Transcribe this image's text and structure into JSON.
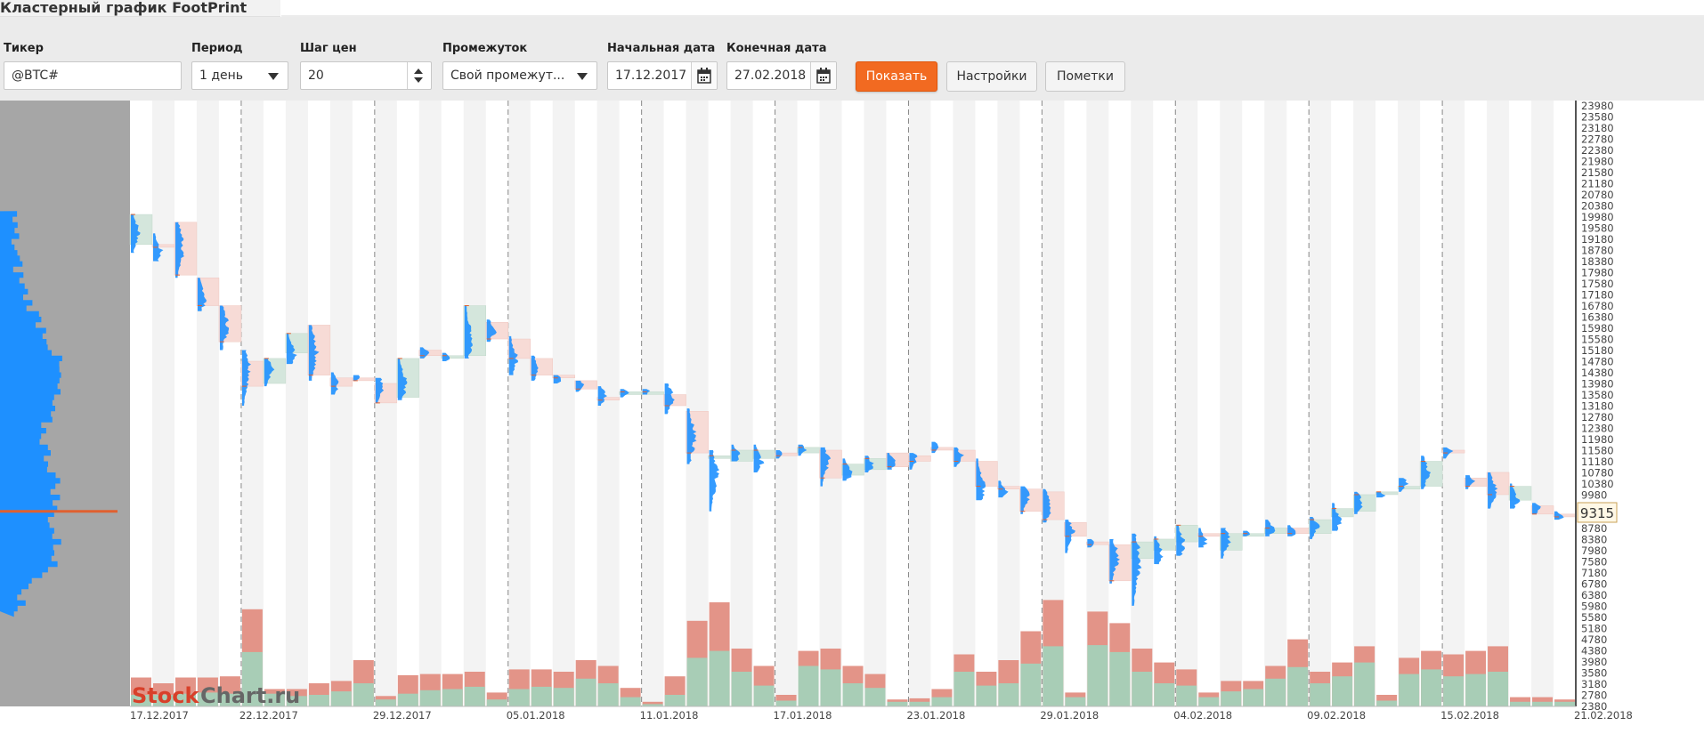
{
  "page": {
    "title": "Кластерный график FootPrint"
  },
  "toolbar": {
    "ticker": {
      "label": "Тикер",
      "value": "@BTC#"
    },
    "period": {
      "label": "Период",
      "value": "1 день"
    },
    "price_step": {
      "label": "Шаг цен",
      "value": "20"
    },
    "range": {
      "label": "Промежуток",
      "value": "Свой промежут..."
    },
    "start_date": {
      "label": "Начальная дата",
      "value": "17.12.2017"
    },
    "end_date": {
      "label": "Конечная дата",
      "value": "27.02.2018"
    },
    "show_label": "Показать",
    "settings_label": "Настройки",
    "marks_label": "Пометки"
  },
  "colors": {
    "accent": "#f26a21",
    "bull": "#a8cdb6",
    "bear": "#e39488",
    "profile": "#1e90ff",
    "poc": "#e06030"
  },
  "watermark": {
    "part1": "Stock",
    "part2": "Chart.ru"
  },
  "chart_data": {
    "type": "footprint",
    "y_ticks": [
      23980,
      23580,
      23180,
      22780,
      22380,
      21980,
      21580,
      21180,
      20780,
      20380,
      19980,
      19580,
      19180,
      18780,
      18380,
      17980,
      17580,
      17180,
      16780,
      16380,
      15980,
      15580,
      15180,
      14780,
      14380,
      13980,
      13580,
      13180,
      12780,
      12380,
      11980,
      11580,
      11180,
      10780,
      10380,
      9980,
      9580,
      9180,
      8780,
      8380,
      7980,
      7580,
      7180,
      6780,
      6380,
      5980,
      5580,
      5180,
      4780,
      4380,
      3980,
      3580,
      3180,
      2780,
      2380
    ],
    "x_labels": [
      "17.12.2017",
      "22.12.2017",
      "29.12.2017",
      "05.01.2018",
      "11.01.2018",
      "17.01.2018",
      "23.01.2018",
      "29.01.2018",
      "04.02.2018",
      "09.02.2018",
      "15.02.2018",
      "21.02.2018"
    ],
    "current_price": "9315",
    "ylim": [
      2380,
      24180
    ],
    "candles": [
      {
        "o": 19000,
        "c": 20080,
        "h": 20080,
        "l": 18700
      },
      {
        "o": 19000,
        "c": 18900,
        "h": 19400,
        "l": 18400
      },
      {
        "o": 19800,
        "c": 17900,
        "h": 19800,
        "l": 17800
      },
      {
        "o": 17800,
        "c": 16800,
        "h": 17800,
        "l": 16600
      },
      {
        "o": 16800,
        "c": 15500,
        "h": 16800,
        "l": 15200
      },
      {
        "o": 14800,
        "c": 13900,
        "h": 15200,
        "l": 13200
      },
      {
        "o": 14000,
        "c": 14900,
        "h": 14900,
        "l": 13900
      },
      {
        "o": 15100,
        "c": 15800,
        "h": 15800,
        "l": 14700
      },
      {
        "o": 16100,
        "c": 14300,
        "h": 16100,
        "l": 14100
      },
      {
        "o": 14200,
        "c": 13900,
        "h": 14400,
        "l": 13600
      },
      {
        "o": 14200,
        "c": 14100,
        "h": 14300,
        "l": 14100
      },
      {
        "o": 14000,
        "c": 13300,
        "h": 14200,
        "l": 13300
      },
      {
        "o": 13500,
        "c": 14900,
        "h": 14900,
        "l": 13400
      },
      {
        "o": 15200,
        "c": 15000,
        "h": 15300,
        "l": 14900
      },
      {
        "o": 15000,
        "c": 15000,
        "h": 15100,
        "l": 14800
      },
      {
        "o": 15000,
        "c": 16800,
        "h": 16800,
        "l": 14900
      },
      {
        "o": 16200,
        "c": 15600,
        "h": 16300,
        "l": 15500
      },
      {
        "o": 15600,
        "c": 14900,
        "h": 15700,
        "l": 14300
      },
      {
        "o": 14900,
        "c": 14300,
        "h": 15000,
        "l": 14100
      },
      {
        "o": 14300,
        "c": 14200,
        "h": 14300,
        "l": 14000
      },
      {
        "o": 14100,
        "c": 13800,
        "h": 14100,
        "l": 13700
      },
      {
        "o": 13500,
        "c": 13400,
        "h": 13900,
        "l": 13200
      },
      {
        "o": 13600,
        "c": 13700,
        "h": 13800,
        "l": 13500
      },
      {
        "o": 13700,
        "c": 13700,
        "h": 13800,
        "l": 13600
      },
      {
        "o": 13600,
        "c": 13200,
        "h": 14000,
        "l": 12900
      },
      {
        "o": 13000,
        "c": 11500,
        "h": 13100,
        "l": 11100
      },
      {
        "o": 11300,
        "c": 11400,
        "h": 11600,
        "l": 9400
      },
      {
        "o": 11200,
        "c": 11600,
        "h": 11800,
        "l": 11200
      },
      {
        "o": 11300,
        "c": 11600,
        "h": 11800,
        "l": 10800
      },
      {
        "o": 11500,
        "c": 11400,
        "h": 11600,
        "l": 11300
      },
      {
        "o": 11500,
        "c": 11700,
        "h": 11800,
        "l": 11400
      },
      {
        "o": 11600,
        "c": 10600,
        "h": 11700,
        "l": 10300
      },
      {
        "o": 10700,
        "c": 11100,
        "h": 11300,
        "l": 10500
      },
      {
        "o": 10900,
        "c": 11300,
        "h": 11400,
        "l": 10800
      },
      {
        "o": 11500,
        "c": 11000,
        "h": 11500,
        "l": 10900
      },
      {
        "o": 11400,
        "c": 11200,
        "h": 11500,
        "l": 10900
      },
      {
        "o": 11700,
        "c": 11600,
        "h": 11900,
        "l": 11500
      },
      {
        "o": 11600,
        "c": 11200,
        "h": 11700,
        "l": 11000
      },
      {
        "o": 11200,
        "c": 10300,
        "h": 11300,
        "l": 9800
      },
      {
        "o": 10300,
        "c": 10200,
        "h": 10500,
        "l": 9900
      },
      {
        "o": 10200,
        "c": 9400,
        "h": 10300,
        "l": 9300
      },
      {
        "o": 10100,
        "c": 9100,
        "h": 10200,
        "l": 9000
      },
      {
        "o": 9000,
        "c": 8500,
        "h": 9100,
        "l": 7900
      },
      {
        "o": 8300,
        "c": 8200,
        "h": 8400,
        "l": 8100
      },
      {
        "o": 8200,
        "c": 6900,
        "h": 8400,
        "l": 6800
      },
      {
        "o": 7700,
        "c": 8300,
        "h": 8600,
        "l": 6000
      },
      {
        "o": 8000,
        "c": 8400,
        "h": 8500,
        "l": 7500
      },
      {
        "o": 8300,
        "c": 8900,
        "h": 8900,
        "l": 7800
      },
      {
        "o": 8600,
        "c": 8500,
        "h": 8800,
        "l": 8100
      },
      {
        "o": 8000,
        "c": 8600,
        "h": 8800,
        "l": 7700
      },
      {
        "o": 8500,
        "c": 8600,
        "h": 8700,
        "l": 8500
      },
      {
        "o": 8600,
        "c": 8800,
        "h": 9100,
        "l": 8500
      },
      {
        "o": 8800,
        "c": 8600,
        "h": 8900,
        "l": 8500
      },
      {
        "o": 8600,
        "c": 9100,
        "h": 9200,
        "l": 8400
      },
      {
        "o": 9200,
        "c": 9500,
        "h": 9700,
        "l": 8700
      },
      {
        "o": 9400,
        "c": 10000,
        "h": 10100,
        "l": 9300
      },
      {
        "o": 10000,
        "c": 10100,
        "h": 10100,
        "l": 9900
      },
      {
        "o": 10200,
        "c": 10300,
        "h": 10600,
        "l": 10100
      },
      {
        "o": 10300,
        "c": 11200,
        "h": 11400,
        "l": 10200
      },
      {
        "o": 11600,
        "c": 11500,
        "h": 11700,
        "l": 11300
      },
      {
        "o": 10600,
        "c": 10300,
        "h": 10700,
        "l": 10200
      },
      {
        "o": 10800,
        "c": 10000,
        "h": 10800,
        "l": 9500
      },
      {
        "o": 9800,
        "c": 10300,
        "h": 10400,
        "l": 9500
      },
      {
        "o": 9600,
        "c": 9300,
        "h": 9700,
        "l": 9300
      },
      {
        "o": 9300,
        "c": 9200,
        "h": 9400,
        "l": 9100
      }
    ],
    "volume_buy": [
      0.1,
      0.1,
      0.11,
      0.12,
      0.11,
      0.47,
      0.11,
      0.09,
      0.1,
      0.13,
      0.2,
      0.06,
      0.11,
      0.14,
      0.15,
      0.17,
      0.06,
      0.15,
      0.17,
      0.16,
      0.24,
      0.2,
      0.08,
      0.02,
      0.1,
      0.42,
      0.48,
      0.3,
      0.18,
      0.05,
      0.35,
      0.32,
      0.2,
      0.16,
      0.04,
      0.04,
      0.08,
      0.3,
      0.18,
      0.2,
      0.37,
      0.52,
      0.08,
      0.53,
      0.47,
      0.3,
      0.2,
      0.18,
      0.08,
      0.13,
      0.15,
      0.24,
      0.34,
      0.2,
      0.26,
      0.38,
      0.05,
      0.28,
      0.32,
      0.26,
      0.28,
      0.3,
      0.04,
      0.04,
      0.04
    ],
    "volume_sell": [
      0.25,
      0.2,
      0.25,
      0.25,
      0.26,
      0.84,
      0.15,
      0.15,
      0.2,
      0.22,
      0.4,
      0.09,
      0.27,
      0.28,
      0.28,
      0.3,
      0.12,
      0.32,
      0.32,
      0.3,
      0.4,
      0.35,
      0.16,
      0.04,
      0.26,
      0.74,
      0.9,
      0.5,
      0.35,
      0.1,
      0.48,
      0.5,
      0.35,
      0.28,
      0.06,
      0.07,
      0.15,
      0.45,
      0.3,
      0.4,
      0.65,
      0.92,
      0.12,
      0.82,
      0.72,
      0.5,
      0.38,
      0.32,
      0.12,
      0.22,
      0.22,
      0.35,
      0.58,
      0.3,
      0.38,
      0.52,
      0.1,
      0.42,
      0.48,
      0.45,
      0.48,
      0.52,
      0.08,
      0.08,
      0.06
    ],
    "grid": true
  }
}
